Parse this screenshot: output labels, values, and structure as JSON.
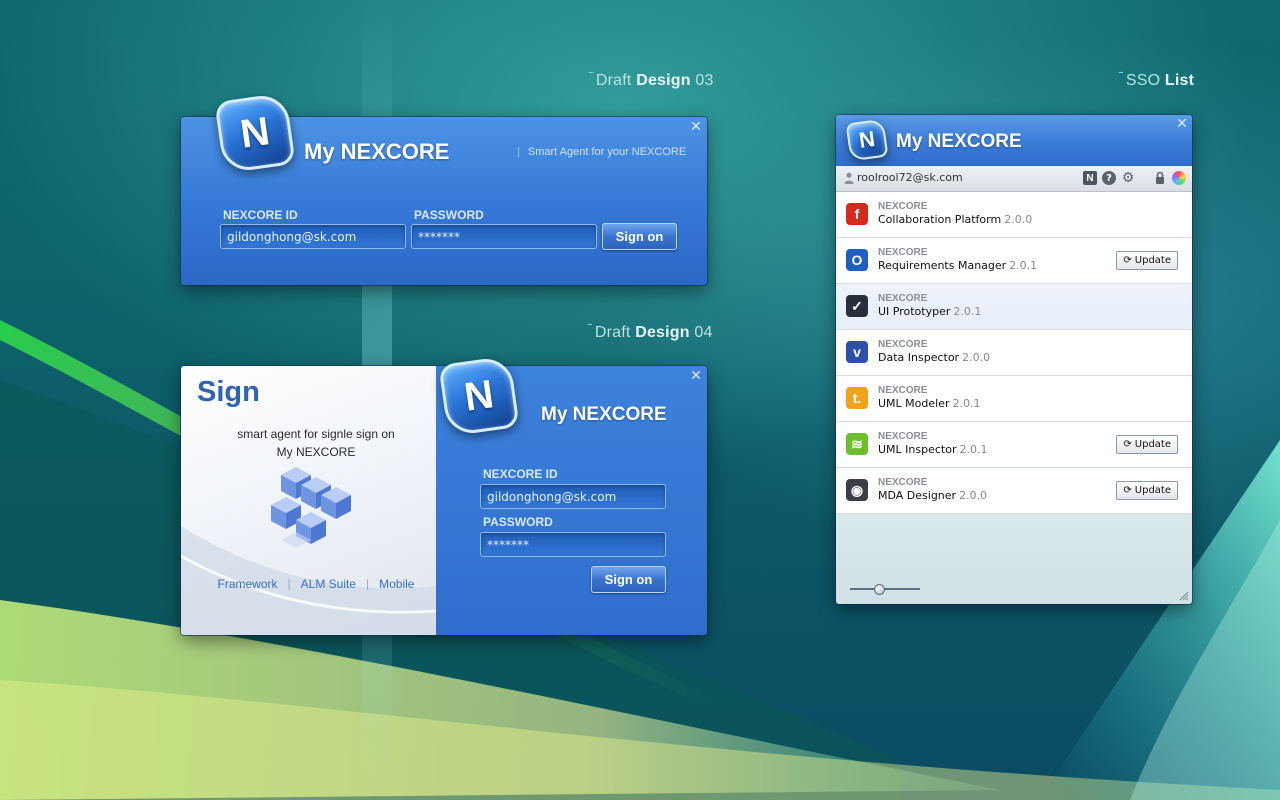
{
  "colors": {
    "window_blue": "#3577d6",
    "header_blue": "#3a7bd7",
    "desktop": "#0d5f6a"
  },
  "draft03": {
    "section_prefix": "Draft",
    "section_bold": "Design",
    "section_suffix": "03",
    "logo_letter": "N",
    "app_title": "My NEXCORE",
    "tagline": "Smart Agent for your NEXCORE",
    "id_label": "NEXCORE ID",
    "id_value": "gildonghong@sk.com",
    "password_label": "PASSWORD",
    "password_value": "*******",
    "signon_label": "Sign on",
    "close_icon": "✕"
  },
  "draft04": {
    "section_prefix": "Draft",
    "section_bold": "Design",
    "section_suffix": "04",
    "sign_title": "Sign",
    "subtitle_line1": "smart agent for signle sign on",
    "subtitle_line2": "My NEXCORE",
    "links": [
      "Framework",
      "ALM Suite",
      "Mobile"
    ],
    "logo_letter": "N",
    "app_title": "My NEXCORE",
    "id_label": "NEXCORE ID",
    "id_value": "gildonghong@sk.com",
    "password_label": "PASSWORD",
    "password_value": "*******",
    "signon_label": "Sign on",
    "close_icon": "✕"
  },
  "sso": {
    "section_prefix": "SSO",
    "section_bold": "List",
    "logo_letter": "N",
    "app_title": "My NEXCORE",
    "user_email": "roolrool72@sk.com",
    "close_icon": "✕",
    "toolbar_icons": [
      "nexcore-icon",
      "help-icon",
      "gear-icon",
      "lock-icon",
      "color-wheel-icon"
    ],
    "update_label": "Update",
    "apps": [
      {
        "vendor": "NEXCORE",
        "name": "Collaboration Platform",
        "version": "2.0.0",
        "icon": "flash-icon",
        "icon_glyph": "f",
        "icon_color": "#d32a1c",
        "update": false
      },
      {
        "vendor": "NEXCORE",
        "name": "Requirements Manager",
        "version": "2.0.1",
        "icon": "ring-icon",
        "icon_glyph": "O",
        "icon_color": "#1f5fc4",
        "update": true
      },
      {
        "vendor": "NEXCORE",
        "name": "UI Prototyper",
        "version": "2.0.1",
        "icon": "check-icon",
        "icon_glyph": "✓",
        "icon_color": "#27303a",
        "update": false
      },
      {
        "vendor": "NEXCORE",
        "name": "Data Inspector",
        "version": "2.0.0",
        "icon": "vimeo-icon",
        "icon_glyph": "v",
        "icon_color": "#2d4fa8",
        "update": false
      },
      {
        "vendor": "NEXCORE",
        "name": "UML Modeler",
        "version": "2.0.1",
        "icon": "t-icon",
        "icon_glyph": "t.",
        "icon_color": "#f0a21b",
        "update": false
      },
      {
        "vendor": "NEXCORE",
        "name": "UML Inspector",
        "version": "2.0.1",
        "icon": "rss-icon",
        "icon_glyph": "≋",
        "icon_color": "#6cbf2a",
        "update": true
      },
      {
        "vendor": "NEXCORE",
        "name": "MDA Designer",
        "version": "2.0.0",
        "icon": "eye-icon",
        "icon_glyph": "◉",
        "icon_color": "#3a3f45",
        "update": true
      }
    ]
  }
}
